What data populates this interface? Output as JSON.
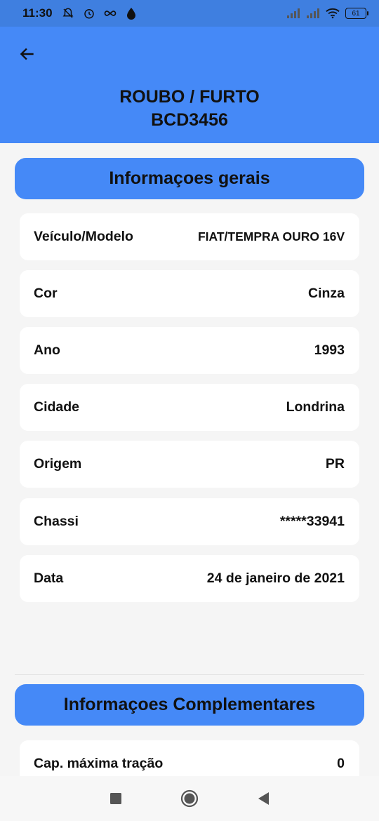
{
  "status_bar": {
    "time": "11:30",
    "icons": [
      "notifications-off-icon",
      "alarm-icon",
      "infinity-icon",
      "drop-icon"
    ],
    "right_icons": [
      "signal-icon",
      "signal-icon",
      "wifi-icon"
    ],
    "battery": "61"
  },
  "header": {
    "title_line1": "ROUBO / FURTO",
    "title_line2": "BCD3456"
  },
  "section_general": {
    "title": "Informaçoes gerais",
    "rows": [
      {
        "label": "Veículo/Modelo",
        "value": "FIAT/TEMPRA OURO 16V"
      },
      {
        "label": "Cor",
        "value": "Cinza"
      },
      {
        "label": "Ano",
        "value": "1993"
      },
      {
        "label": "Cidade",
        "value": "Londrina"
      },
      {
        "label": "Origem",
        "value": "PR"
      },
      {
        "label": "Chassi",
        "value": "*****33941"
      },
      {
        "label": "Data",
        "value": "24 de janeiro de 2021"
      }
    ]
  },
  "section_complementary": {
    "title": "Informaçoes Complementares",
    "rows": [
      {
        "label": "Cap. máxima tração",
        "value": "0"
      }
    ]
  },
  "nav": {
    "icons": [
      "recent-apps-icon",
      "home-icon",
      "back-nav-icon"
    ]
  },
  "colors": {
    "accent": "#4589f7",
    "status_bar": "#3f7fe0",
    "background": "#f5f5f5",
    "card": "#ffffff"
  }
}
